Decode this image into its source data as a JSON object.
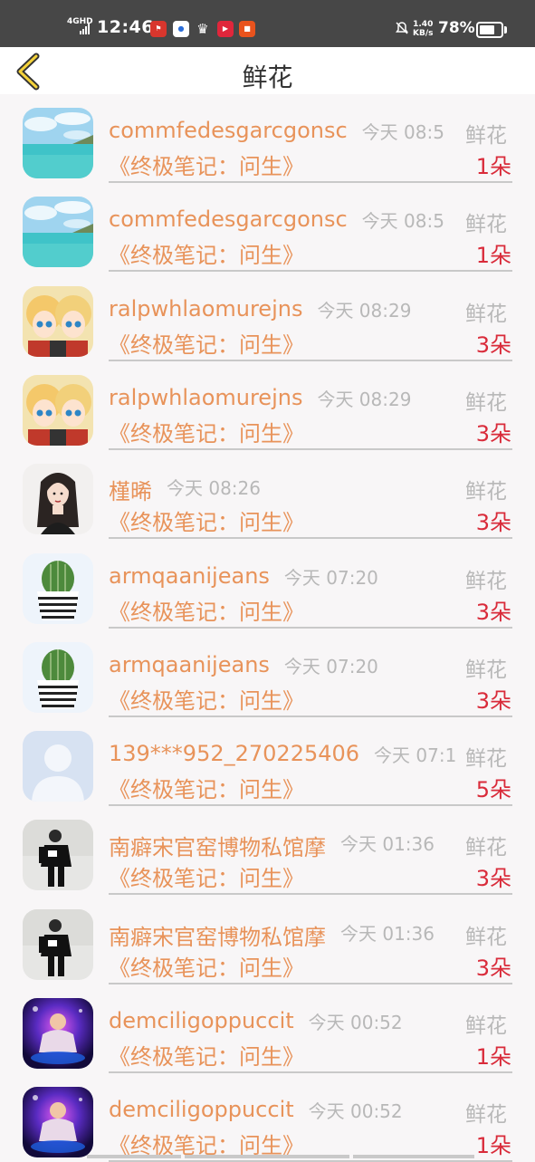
{
  "status_bar": {
    "network": "4GHD",
    "time": "12:46",
    "speed": "1.40",
    "speed_unit": "KB/s",
    "battery": "78%",
    "battery_level": 0.78,
    "app_icons": [
      "news-icon",
      "game-icon",
      "crown-icon",
      "video-icon",
      "shop-icon"
    ]
  },
  "header": {
    "title": "鲜花",
    "back_icon": "chevron-left-icon"
  },
  "rows": [
    {
      "name": "commfedesgarcgonsc",
      "time": "今天 08:5",
      "gift": "鲜花",
      "book": "《终极笔记：问生》",
      "count": "1朵",
      "avatar": "sea"
    },
    {
      "name": "commfedesgarcgonsc",
      "time": "今天 08:5",
      "gift": "鲜花",
      "book": "《终极笔记：问生》",
      "count": "1朵",
      "avatar": "sea"
    },
    {
      "name": "ralpwhlaomurejns",
      "time": "今天 08:29",
      "gift": "鲜花",
      "book": "《终极笔记：问生》",
      "count": "3朵",
      "avatar": "anime"
    },
    {
      "name": "ralpwhlaomurejns",
      "time": "今天 08:29",
      "gift": "鲜花",
      "book": "《终极笔记：问生》",
      "count": "3朵",
      "avatar": "anime"
    },
    {
      "name": "槿晞",
      "time": "今天 08:26",
      "gift": "鲜花",
      "book": "《终极笔记：问生》",
      "count": "3朵",
      "avatar": "girl"
    },
    {
      "name": "armqaanijeans",
      "time": "今天 07:20",
      "gift": "鲜花",
      "book": "《终极笔记：问生》",
      "count": "3朵",
      "avatar": "cactus"
    },
    {
      "name": "armqaanijeans",
      "time": "今天 07:20",
      "gift": "鲜花",
      "book": "《终极笔记：问生》",
      "count": "3朵",
      "avatar": "cactus"
    },
    {
      "name": "139***952_270225406",
      "time": "今天 07:1",
      "gift": "鲜花",
      "book": "《终极笔记：问生》",
      "count": "5朵",
      "avatar": "default"
    },
    {
      "name": "南癖宋官窑博物私馆摩",
      "time": "今天 01:36",
      "gift": "鲜花",
      "book": "《终极笔记：问生》",
      "count": "3朵",
      "avatar": "man"
    },
    {
      "name": "南癖宋官窑博物私馆摩",
      "time": "今天 01:36",
      "gift": "鲜花",
      "book": "《终极笔记：问生》",
      "count": "3朵",
      "avatar": "man"
    },
    {
      "name": "demciligoppuccit",
      "time": "今天 00:52",
      "gift": "鲜花",
      "book": "《终极笔记：问生》",
      "count": "1朵",
      "avatar": "dj"
    },
    {
      "name": "demciligoppuccit",
      "time": "今天 00:52",
      "gift": "鲜花",
      "book": "《终极笔记：问生》",
      "count": "1朵",
      "avatar": "dj"
    }
  ]
}
